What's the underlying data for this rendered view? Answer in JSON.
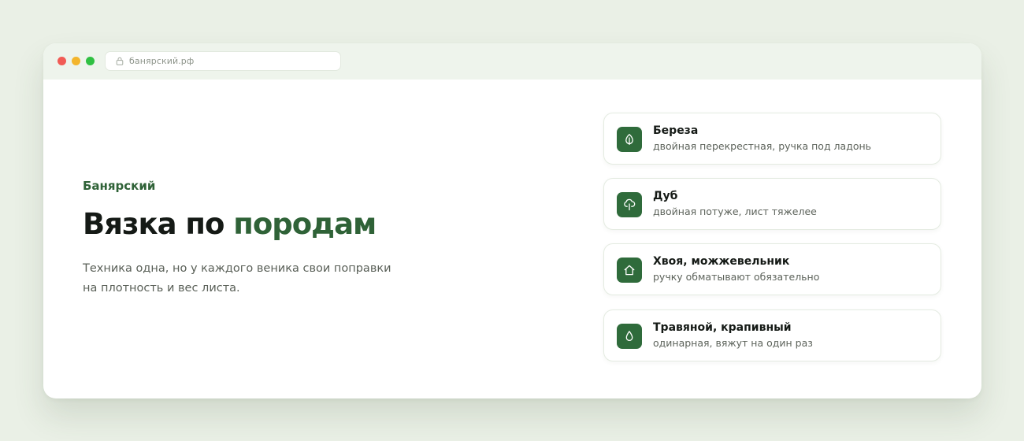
{
  "browser": {
    "url": "банярский.рф"
  },
  "hero": {
    "brand": "Банярский",
    "title_main": "Вязка по ",
    "title_accent": "породам",
    "lead": "Техника одна, но у каждого веника свои поправки на плотность и вес листа."
  },
  "cards": [
    {
      "icon": "leaf-icon",
      "title": "Береза",
      "desc": "двойная перекрестная, ручка под ладонь"
    },
    {
      "icon": "tree-icon",
      "title": "Дуб",
      "desc": "двойная потуже, лист тяжелее"
    },
    {
      "icon": "house-icon",
      "title": "Хвоя, можжевельник",
      "desc": "ручку обматывают обязательно"
    },
    {
      "icon": "drop-icon",
      "title": "Травяной, крапивный",
      "desc": "одинарная, вяжут на один раз"
    }
  ],
  "colors": {
    "accent": "#2f6237",
    "icon_bg": "#2f6b3b",
    "page_bg": "#eaf0e6"
  }
}
